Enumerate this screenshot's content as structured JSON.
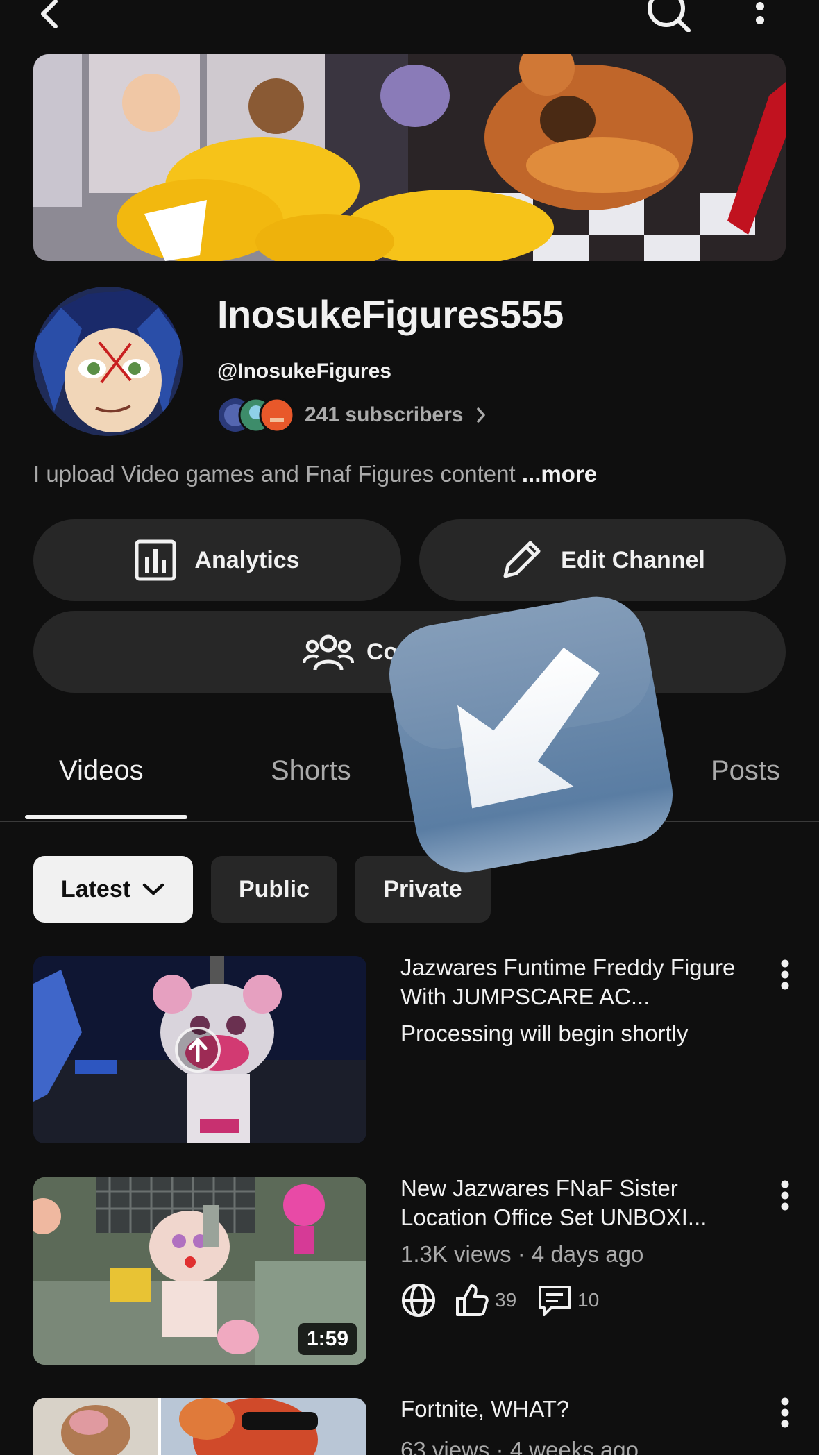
{
  "channel": {
    "name": "InosukeFigures555",
    "handle": "@InosukeFigures",
    "subscribers": "241 subscribers",
    "description": "I upload Video games and Fnaf Figures content",
    "more_label": "...more"
  },
  "actions": {
    "analytics_label": "Analytics",
    "edit_channel_label": "Edit Channel",
    "community_label_visible": "Co"
  },
  "tabs": [
    {
      "label": "Videos",
      "selected": true
    },
    {
      "label": "Shorts",
      "selected": false
    },
    {
      "label": "Posts",
      "selected": false
    }
  ],
  "filters": {
    "sort_label": "Latest",
    "public_label": "Public",
    "private_label": "Private"
  },
  "videos": [
    {
      "title": "Jazwares Funtime Freddy Figure With JUMPSCARE AC...",
      "subtitle": "Processing will begin shortly"
    },
    {
      "title": "New Jazwares FNaF Sister Location Office Set UNBOXI...",
      "subtitle": "1.3K views · 4 days ago",
      "duration": "1:59",
      "likes": "39",
      "comments": "10"
    },
    {
      "title": "Fortnite, WHAT?",
      "subtitle": "63 views · 4 weeks ago"
    }
  ],
  "icons": {
    "back": "back-arrow-icon",
    "search": "search-icon",
    "more": "more-vert-icon",
    "analytics": "bar-chart-icon",
    "edit": "pencil-icon",
    "community": "people-icon",
    "upload": "upload-arrow-icon",
    "visibility": "globe-icon",
    "likes": "thumbs-up-icon",
    "comments": "comment-icon",
    "overlay": "arrow-down-left-icon"
  },
  "colors": {
    "background": "#0f0f0f",
    "surface": "#272727",
    "text_primary": "#f1f1f1",
    "text_secondary": "#aaaaaa",
    "selected_chip": "#f1f1f1"
  }
}
